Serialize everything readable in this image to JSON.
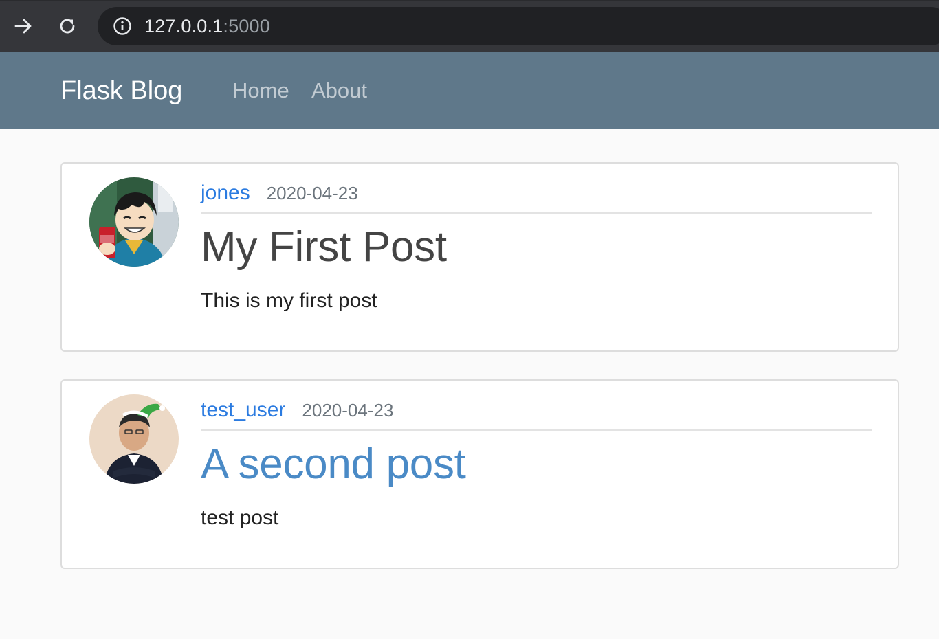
{
  "browser": {
    "url_host": "127.0.0.1",
    "url_port": ":5000",
    "icons": {
      "forward": "arrow-right-icon",
      "reload": "reload-icon",
      "info": "info-icon"
    }
  },
  "navbar": {
    "brand": "Flask Blog",
    "links": [
      "Home",
      "About"
    ],
    "background": "#5f788a"
  },
  "posts": [
    {
      "author": "jones",
      "date": "2020-04-23",
      "title": "My First Post",
      "content": "This is my first post"
    },
    {
      "author": "test_user",
      "date": "2020-04-23",
      "title": "A second post",
      "content": "test post"
    }
  ],
  "colors": {
    "link": "#2b7be0",
    "title_hover": "#4a8ac6",
    "muted": "#6c757d"
  }
}
